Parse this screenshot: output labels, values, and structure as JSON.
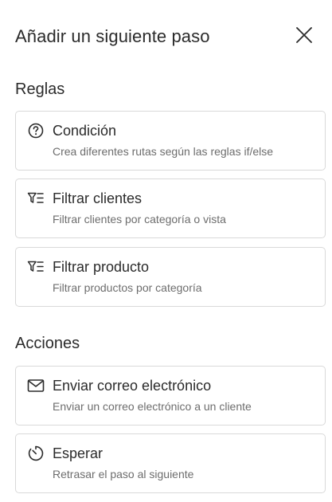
{
  "header": {
    "title": "Añadir un siguiente paso",
    "close_icon": "close-icon"
  },
  "sections": {
    "rules": {
      "heading": "Reglas",
      "items": [
        {
          "icon": "question-circle-icon",
          "title": "Condición",
          "description": "Crea diferentes rutas según las reglas if/else"
        },
        {
          "icon": "filter-list-icon",
          "title": "Filtrar clientes",
          "description": "Filtrar clientes por categoría o vista"
        },
        {
          "icon": "filter-list-icon",
          "title": "Filtrar producto",
          "description": "Filtrar productos por categoría"
        }
      ]
    },
    "actions": {
      "heading": "Acciones",
      "items": [
        {
          "icon": "envelope-icon",
          "title": "Enviar correo electrónico",
          "description": "Enviar un correo electrónico a un cliente"
        },
        {
          "icon": "timer-icon",
          "title": "Esperar",
          "description": "Retrasar el paso al siguiente"
        }
      ]
    }
  },
  "colors": {
    "text": "#2b2b2b",
    "muted": "#6d6d6d",
    "border": "#d9d9d9",
    "background": "#ffffff"
  }
}
